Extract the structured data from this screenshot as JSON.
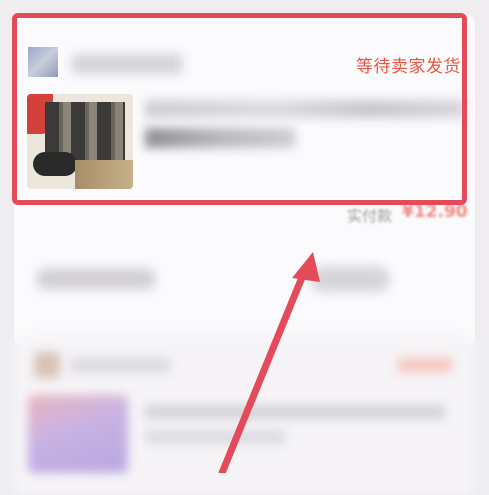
{
  "order_card": {
    "status": "等待卖家发货",
    "total_label": "实付款",
    "total_value": "¥12.90"
  },
  "icons": {
    "annotation": "arrow-up-icon"
  },
  "colors": {
    "status_text": "#e8553f",
    "highlight": "#e34a5a",
    "page_bg": "#efedf0"
  }
}
